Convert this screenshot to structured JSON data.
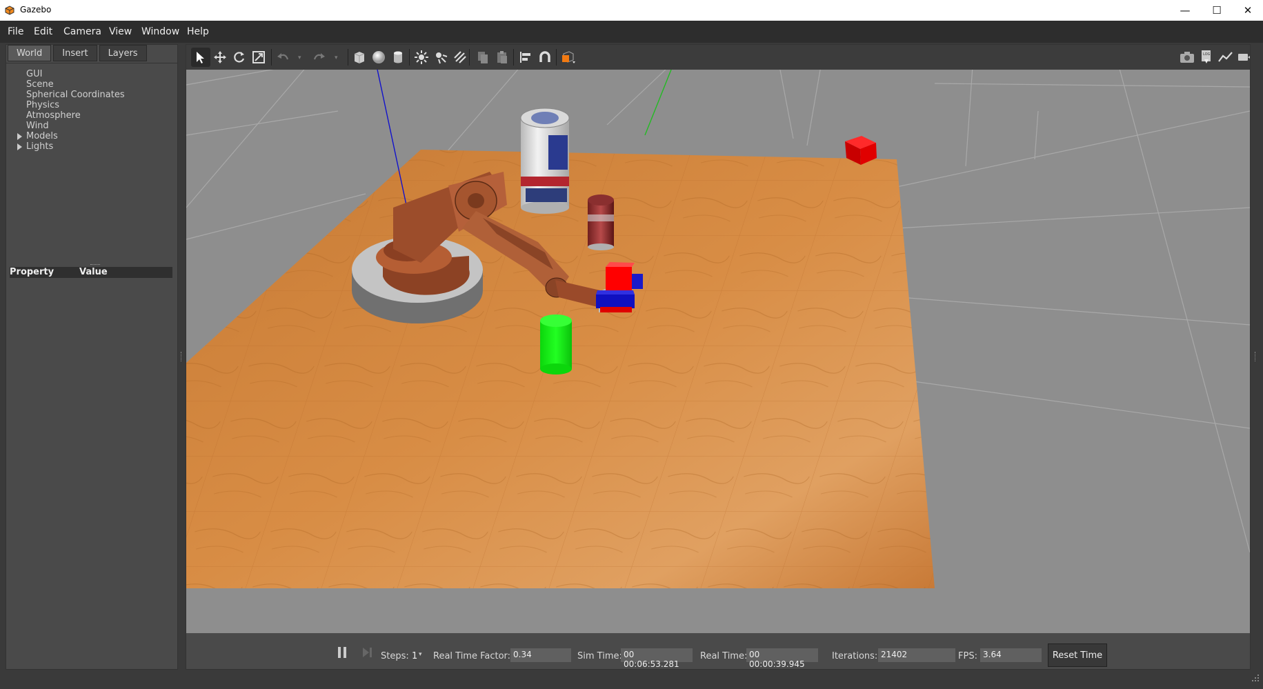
{
  "window": {
    "title": "Gazebo"
  },
  "menu": [
    "File",
    "Edit",
    "Camera",
    "View",
    "Window",
    "Help"
  ],
  "left_panel": {
    "tabs": [
      "World",
      "Insert",
      "Layers"
    ],
    "tree": [
      "GUI",
      "Scene",
      "Spherical Coordinates",
      "Physics",
      "Atmosphere",
      "Wind",
      "Models",
      "Lights"
    ],
    "property_header": {
      "property": "Property",
      "value": "Value"
    }
  },
  "toolbar": {
    "icons": [
      "select-arrow-icon",
      "translate-icon",
      "rotate-icon",
      "scale-icon",
      "undo-icon",
      "redo-icon",
      "box-icon",
      "sphere-icon",
      "cylinder-icon",
      "point-light-icon",
      "spot-light-icon",
      "directional-light-icon",
      "copy-icon",
      "paste-icon",
      "align-icon",
      "magnet-icon",
      "view-angle-icon",
      "screenshot-icon",
      "log-icon",
      "plot-icon",
      "video-record-icon"
    ]
  },
  "bottom": {
    "steps_label": "Steps:",
    "steps_value": "1",
    "rtf_label": "Real Time Factor:",
    "rtf_value": "0.34",
    "sim_time_label": "Sim Time:",
    "sim_time_value": "00 00:06:53.281",
    "real_time_label": "Real Time:",
    "real_time_value": "00 00:00:39.945",
    "iterations_label": "Iterations:",
    "iterations_value": "21402",
    "fps_label": "FPS:",
    "fps_value": "3.64",
    "reset_label": "Reset Time"
  },
  "colors": {
    "sky": "#8f8f8f",
    "table": "#c9772f",
    "arm": "#a95a34",
    "green_cylinder": "#10ff10",
    "red_cube": "#dd0000",
    "gripper_red": "#ff0000",
    "gripper_blue": "#0000d0"
  }
}
